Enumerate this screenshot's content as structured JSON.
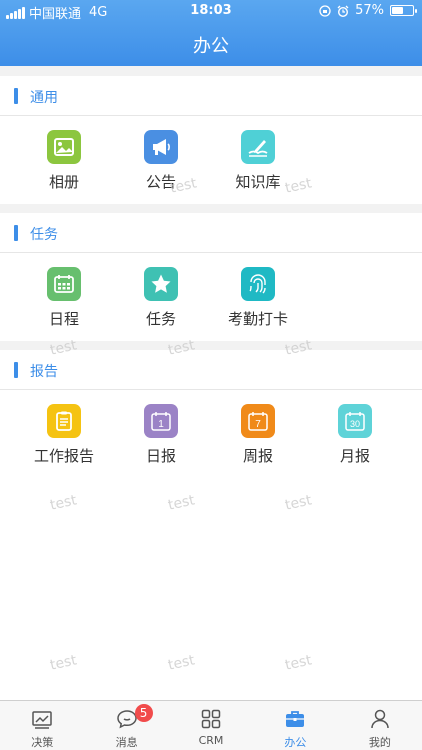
{
  "status_bar": {
    "carrier": "中国联通",
    "network": "4G",
    "time": "18:03",
    "battery": "57%",
    "battery_level": 0.57
  },
  "header": {
    "title": "办公"
  },
  "sections": [
    {
      "title": "通用",
      "items": [
        {
          "label": "相册",
          "icon": "photo-album-icon",
          "color": "#8cc63f"
        },
        {
          "label": "公告",
          "icon": "megaphone-icon",
          "color": "#4a8fe2"
        },
        {
          "label": "知识库",
          "icon": "book-pen-icon",
          "color": "#4fd0d6"
        }
      ]
    },
    {
      "title": "任务",
      "items": [
        {
          "label": "日程",
          "icon": "calendar-icon",
          "color": "#67bf6e"
        },
        {
          "label": "任务",
          "icon": "star-icon",
          "color": "#3fc1b3"
        },
        {
          "label": "考勤打卡",
          "icon": "fingerprint-icon",
          "color": "#1fb9c4"
        }
      ]
    },
    {
      "title": "报告",
      "items": [
        {
          "label": "工作报告",
          "icon": "clipboard-icon",
          "color": "#f5c312"
        },
        {
          "label": "日报",
          "icon": "calendar-1-icon",
          "color": "#9b83c6",
          "number": "1"
        },
        {
          "label": "周报",
          "icon": "calendar-7-icon",
          "color": "#f08a19",
          "number": "7"
        },
        {
          "label": "月报",
          "icon": "calendar-30-icon",
          "color": "#5ed3d8",
          "number": "30"
        }
      ]
    }
  ],
  "watermark": "test",
  "tabbar": [
    {
      "label": "决策",
      "icon": "chart-icon",
      "active": false
    },
    {
      "label": "消息",
      "icon": "chat-icon",
      "active": false,
      "badge": "5"
    },
    {
      "label": "CRM",
      "icon": "grid-icon",
      "active": false
    },
    {
      "label": "办公",
      "icon": "briefcase-icon",
      "active": true
    },
    {
      "label": "我的",
      "icon": "person-icon",
      "active": false
    }
  ],
  "colors": {
    "accent": "#3d8ee8",
    "badge": "#f14b4b"
  }
}
